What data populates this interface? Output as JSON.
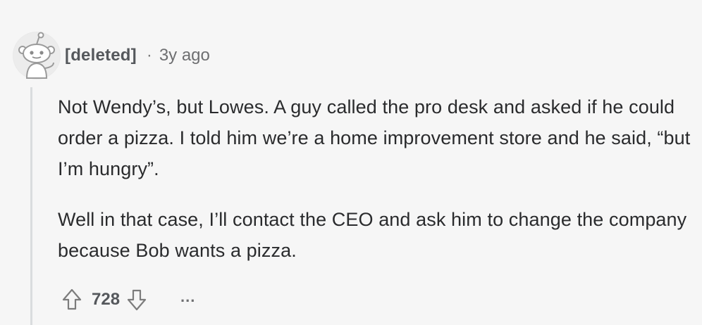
{
  "comment": {
    "author": "[deleted]",
    "separator": "·",
    "age": "3y ago",
    "paragraphs": [
      "Not Wendy’s, but Lowes. A guy called the pro desk and asked if he could order a pizza. I told him we’re a home improvement store and he said, “but I’m hungry”.",
      "Well in that case, I’ll contact the CEO and ask him to change the company because Bob wants a pizza."
    ],
    "score": "728",
    "more_label": "..."
  },
  "icons": {
    "avatar": "deleted-user-avatar-icon",
    "upvote": "upvote-arrow-icon",
    "downvote": "downvote-arrow-icon",
    "more": "more-options-icon"
  },
  "colors": {
    "background": "#f6f6f6",
    "text": "#2a2b2d",
    "meta": "#6e6f71",
    "thread_line": "#dadcde"
  }
}
